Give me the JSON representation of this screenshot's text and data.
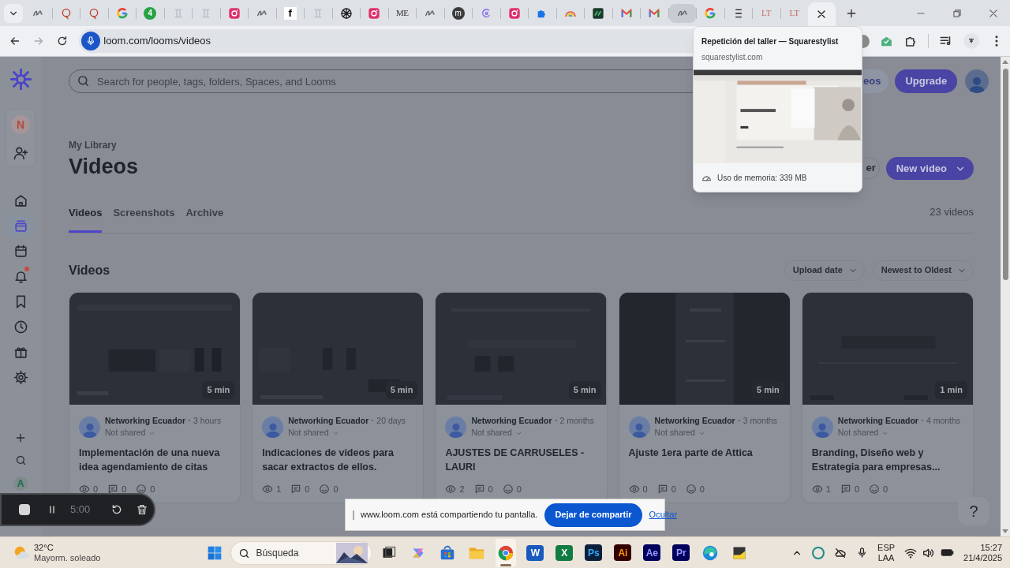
{
  "browser": {
    "tabs": [
      {
        "kind": "script",
        "selected": false,
        "hovered": false
      },
      {
        "kind": "ring",
        "selected": false,
        "hovered": false
      },
      {
        "kind": "ring",
        "selected": false,
        "hovered": false
      },
      {
        "kind": "g_logo",
        "selected": false,
        "hovered": false
      },
      {
        "kind": "green_circle",
        "label": "4",
        "selected": false,
        "hovered": false
      },
      {
        "kind": "faint",
        "selected": false,
        "hovered": false
      },
      {
        "kind": "faint",
        "selected": false,
        "hovered": false
      },
      {
        "kind": "camera",
        "selected": false,
        "hovered": false
      },
      {
        "kind": "script",
        "selected": false,
        "hovered": false
      },
      {
        "kind": "square",
        "label": "f",
        "selected": false,
        "hovered": false
      },
      {
        "kind": "faint",
        "selected": false,
        "hovered": false
      },
      {
        "kind": "globe",
        "selected": false,
        "hovered": false
      },
      {
        "kind": "camera",
        "selected": false,
        "hovered": false
      },
      {
        "kind": "plain",
        "label": "ME",
        "selected": false,
        "hovered": false
      },
      {
        "kind": "script",
        "selected": false,
        "hovered": false
      },
      {
        "kind": "dark_circle",
        "label": "m",
        "selected": false,
        "hovered": false
      },
      {
        "kind": "crescent",
        "selected": false,
        "hovered": false
      },
      {
        "kind": "camera",
        "selected": false,
        "hovered": false
      },
      {
        "kind": "puzzle",
        "selected": false,
        "hovered": false
      },
      {
        "kind": "rainbow",
        "selected": false,
        "hovered": false
      },
      {
        "kind": "check_square",
        "selected": false,
        "hovered": false
      },
      {
        "kind": "envelope",
        "selected": false,
        "hovered": false
      },
      {
        "kind": "envelope",
        "selected": false,
        "hovered": false
      },
      {
        "kind": "script",
        "selected": false,
        "hovered": true
      },
      {
        "kind": "g_logo",
        "selected": false,
        "hovered": false
      },
      {
        "kind": "bars",
        "selected": false,
        "hovered": false
      },
      {
        "kind": "serif_red",
        "label": "LT",
        "selected": false,
        "hovered": false
      },
      {
        "kind": "serif_red",
        "label": "LT",
        "selected": false,
        "hovered": false
      },
      {
        "kind": "close",
        "selected": true,
        "hovered": false
      }
    ],
    "address": "loom.com/looms/videos",
    "hover_card": {
      "title": "Repetición del taller — Squarestylist",
      "domain": "squarestylist.com",
      "memory": "Uso de memoria: 339 MB"
    }
  },
  "sidebar": {
    "workspace_initial": "N",
    "nav": [
      {
        "kind": "home",
        "selected": false,
        "unread": false
      },
      {
        "kind": "library",
        "selected": true,
        "unread": false
      },
      {
        "kind": "calendar",
        "selected": false,
        "unread": false
      },
      {
        "kind": "bell",
        "selected": false,
        "unread": true
      },
      {
        "kind": "bookmark",
        "selected": false,
        "unread": false
      },
      {
        "kind": "clock",
        "selected": false,
        "unread": false
      },
      {
        "kind": "gift",
        "selected": false,
        "unread": false
      },
      {
        "kind": "gear",
        "selected": false,
        "unread": false
      }
    ],
    "bottom_letter": "A"
  },
  "header": {
    "search_placeholder": "Search for people, tags, folders, Spaces, and Looms",
    "partial_button": "eos",
    "upgrade": "Upgrade"
  },
  "library": {
    "breadcrumb": "My Library",
    "title": "Videos",
    "tabs": [
      {
        "label": "Videos",
        "selected": true
      },
      {
        "label": "Screenshots",
        "selected": false
      },
      {
        "label": "Archive",
        "selected": false
      }
    ],
    "count": "23 videos",
    "partial_button": "er",
    "new_video": "New video",
    "section": "Videos",
    "sorts": [
      "Upload date",
      "Newest to Oldest"
    ],
    "videos": [
      {
        "duration": "5 min",
        "author": "Networking Ecuador",
        "age": "3 hours",
        "sharing": "Not shared",
        "title": "Implementación de una nueva idea agendamiento de citas",
        "views": "0",
        "comments": "0",
        "reactions": "0"
      },
      {
        "duration": "5 min",
        "author": "Networking Ecuador",
        "age": "20 days",
        "sharing": "Not shared",
        "title": "Indicaciones de videos para sacar extractos de ellos.",
        "views": "1",
        "comments": "0",
        "reactions": "0"
      },
      {
        "duration": "5 min",
        "author": "Networking Ecuador",
        "age": "2 months",
        "sharing": "Not shared",
        "title": "AJUSTES DE CARRUSELES - LAURI",
        "views": "2",
        "comments": "0",
        "reactions": "0"
      },
      {
        "duration": "5 min",
        "author": "Networking Ecuador",
        "age": "3 months",
        "sharing": "Not shared",
        "title": "Ajuste 1era parte de Attica",
        "views": "0",
        "comments": "0",
        "reactions": "0"
      },
      {
        "duration": "1 min",
        "author": "Networking Ecuador",
        "age": "4 months",
        "sharing": "Not shared",
        "title": "Branding, Diseño web y Estrategia para empresas...",
        "views": "1",
        "comments": "0",
        "reactions": "0"
      }
    ]
  },
  "recorder": {
    "time": "5:00"
  },
  "share_bar": {
    "message": "www.loom.com está compartiendo tu pantalla.",
    "stop": "Dejar de compartir",
    "hide": "Ocultar"
  },
  "help": "?",
  "taskbar": {
    "temperature": "32°C",
    "weather": "Mayorm. soleado",
    "search_placeholder": "Búsqueda",
    "apps": [
      {
        "kind": "task_view",
        "active": false
      },
      {
        "kind": "sparkle",
        "active": false
      },
      {
        "kind": "store",
        "active": false
      },
      {
        "kind": "folder",
        "active": false
      },
      {
        "kind": "chrome",
        "active": true
      },
      {
        "kind": "doc",
        "label": "W",
        "active": false
      },
      {
        "kind": "sheet",
        "label": "X",
        "active": false
      },
      {
        "kind": "tile",
        "label": "Ps",
        "active": false
      },
      {
        "kind": "tile_orange",
        "label": "Ai",
        "active": false
      },
      {
        "kind": "tile_violet",
        "label": "Ae",
        "active": false
      },
      {
        "kind": "tile_violet",
        "label": "Pr",
        "active": false
      },
      {
        "kind": "edge",
        "active": false
      },
      {
        "kind": "note",
        "active": false
      }
    ],
    "language": "ESP",
    "layout": "LAA",
    "time": "15:27",
    "date": "21/4/2025"
  }
}
